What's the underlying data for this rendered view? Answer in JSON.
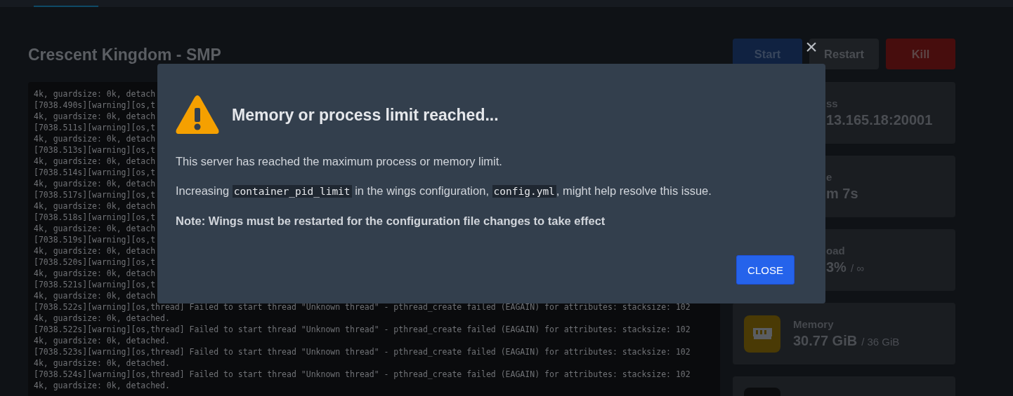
{
  "server_title": "Crescent Kingdom - SMP",
  "power_buttons": [
    {
      "label": "Start",
      "kind": "start"
    },
    {
      "label": "Restart",
      "kind": "restart"
    },
    {
      "label": "Kill",
      "kind": "kill"
    }
  ],
  "console_lines": [
    "4k, guardsize: 0k, detach",
    "[7038.490s][warning][os,t",
    "4k, guardsize: 0k, detach",
    "[7038.511s][warning][os,t",
    "4k, guardsize: 0k, detach",
    "[7038.513s][warning][os,t",
    "4k, guardsize: 0k, detach",
    "[7038.514s][warning][os,t",
    "4k, guardsize: 0k, detach",
    "[7038.517s][warning][os,t",
    "4k, guardsize: 0k, detach",
    "[7038.518s][warning][os,t",
    "4k, guardsize: 0k, detach",
    "[7038.519s][warning][os,t",
    "4k, guardsize: 0k, detach",
    "[7038.520s][warning][os,t",
    "4k, guardsize: 0k, detach",
    "[7038.521s][warning][os,t",
    "4k, guardsize: 0k, detach",
    "[7038.522s][warning][os,thread] Failed to start thread \"Unknown thread\" - pthread_create failed (EAGAIN) for attributes: stacksize: 102",
    "4k, guardsize: 0k, detached.",
    "[7038.522s][warning][os,thread] Failed to start thread \"Unknown thread\" - pthread_create failed (EAGAIN) for attributes: stacksize: 102",
    "4k, guardsize: 0k, detached.",
    "[7038.523s][warning][os,thread] Failed to start thread \"Unknown thread\" - pthread_create failed (EAGAIN) for attributes: stacksize: 102",
    "4k, guardsize: 0k, detached.",
    "[7038.524s][warning][os,thread] Failed to start thread \"Unknown thread\" - pthread_create failed (EAGAIN) for attributes: stacksize: 102",
    "4k, guardsize: 0k, detached."
  ],
  "stat_cards": [
    {
      "kind": "covered",
      "label": "ss",
      "value": "13.165.18:20001"
    },
    {
      "kind": "covered",
      "label": "e",
      "value": "m 7s"
    },
    {
      "kind": "covered",
      "label": "oad",
      "value": "3%",
      "limit": "/ ∞"
    },
    {
      "kind": "icon",
      "color": "#4a3a05",
      "label": "Memory",
      "value": "30.77 GiB",
      "limit": "/ 36 GiB"
    },
    {
      "kind": "icon",
      "color": "#0b0c0e"
    }
  ],
  "dialog": {
    "title": "Memory or process limit reached...",
    "paragraphs": [
      {
        "kind": "plain",
        "parts": [
          {
            "text": "This server has reached the maximum process or memory limit."
          }
        ]
      },
      {
        "kind": "plain",
        "parts": [
          {
            "text": "Increasing "
          },
          {
            "text": "container_pid_limit",
            "kind": "code"
          },
          {
            "text": " in the wings configuration, "
          },
          {
            "text": "config.yml",
            "kind": "code"
          },
          {
            "text": ", might help resolve this issue."
          }
        ]
      },
      {
        "kind": "note",
        "parts": [
          {
            "text": "Note: Wings must be restarted for the configuration file changes to take effect"
          }
        ]
      }
    ],
    "button": "CLOSE",
    "close_icon": "×"
  }
}
